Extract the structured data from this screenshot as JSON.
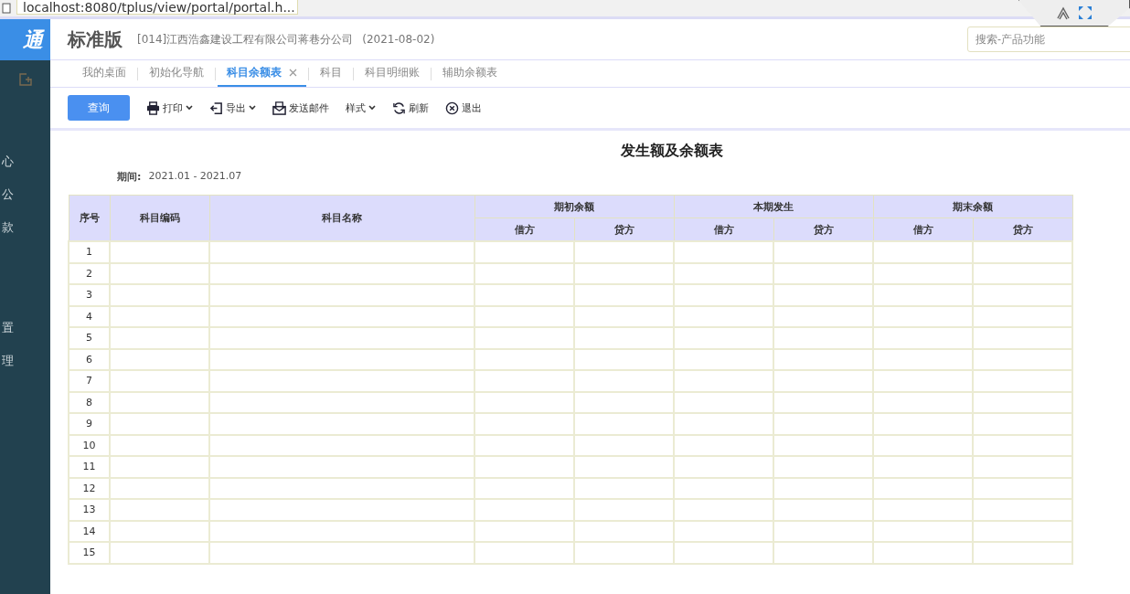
{
  "browser": {
    "address": "localhost:8080/tplus/view/portal/portal.h..."
  },
  "sidebar": {
    "logo": "通",
    "items": [
      "心",
      "公",
      "款",
      "置",
      "理"
    ]
  },
  "header": {
    "edition": "标准版",
    "company": "[014]江西浩鑫建设工程有限公司蒋巷分公司",
    "date": "(2021-08-02)",
    "search": {
      "placeholder": "搜索-产品功能"
    }
  },
  "tabs": [
    {
      "label": "我的桌面",
      "selected": false,
      "closable": false
    },
    {
      "label": "初始化导航",
      "selected": false,
      "closable": false
    },
    {
      "label": "科目余额表",
      "selected": true,
      "closable": true
    },
    {
      "label": "科目",
      "selected": false,
      "closable": false
    },
    {
      "label": "科目明细账",
      "selected": false,
      "closable": false
    },
    {
      "label": "辅助余额表",
      "selected": false,
      "closable": false
    }
  ],
  "toolbar": {
    "query": "查询",
    "items": [
      {
        "kind": "print",
        "label": "打印",
        "dropdown": true
      },
      {
        "kind": "export",
        "label": "导出",
        "dropdown": true
      },
      {
        "kind": "mail",
        "label": "发送邮件",
        "dropdown": false
      },
      {
        "kind": "style",
        "label": "样式",
        "dropdown": true
      },
      {
        "kind": "refresh",
        "label": "刷新",
        "dropdown": false
      },
      {
        "kind": "exit",
        "label": "退出",
        "dropdown": false
      }
    ]
  },
  "report": {
    "title": "发生额及余额表",
    "period_label": "期间:",
    "period": "2021.01 - 2021.07",
    "columns": [
      "序号",
      "科目编码",
      "科目名称"
    ],
    "groups": [
      {
        "label": "期初余额",
        "sub": [
          "借方",
          "贷方"
        ]
      },
      {
        "label": "本期发生",
        "sub": [
          "借方",
          "贷方"
        ]
      },
      {
        "label": "期末余额",
        "sub": [
          "借方",
          "贷方"
        ]
      }
    ],
    "rows": [
      "1",
      "2",
      "3",
      "4",
      "5",
      "6",
      "7",
      "8",
      "9",
      "10",
      "11",
      "12",
      "13",
      "14",
      "15"
    ]
  }
}
